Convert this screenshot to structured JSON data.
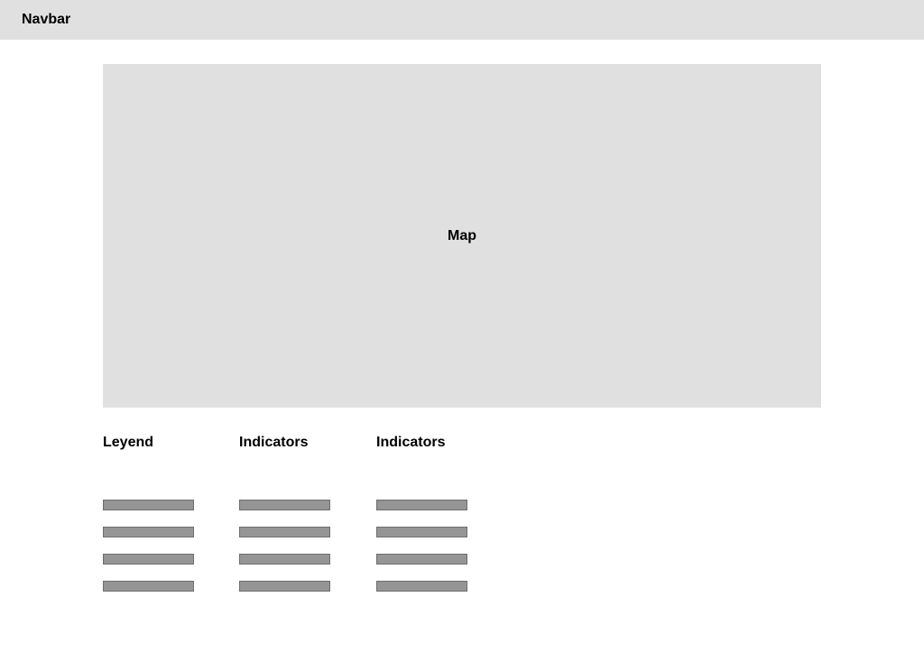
{
  "navbar": {
    "title": "Navbar"
  },
  "map": {
    "label": "Map"
  },
  "columns": [
    {
      "title": "Leyend",
      "bar_count": 4
    },
    {
      "title": "Indicators",
      "bar_count": 4
    },
    {
      "title": "Indicators",
      "bar_count": 4
    }
  ],
  "colors": {
    "panel_background": "#e0e0e0",
    "bar_fill": "#959595",
    "page_background": "#ffffff"
  }
}
